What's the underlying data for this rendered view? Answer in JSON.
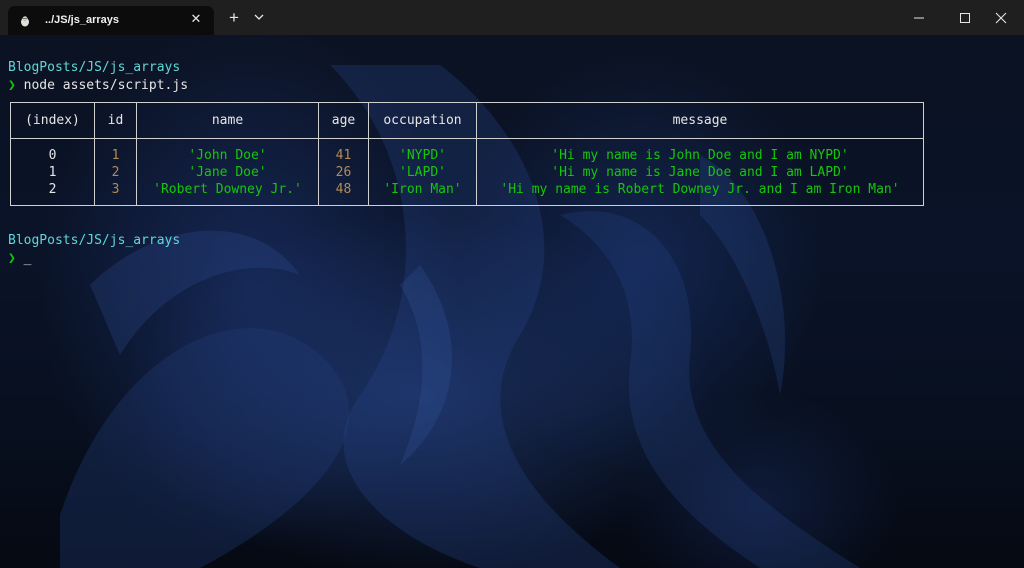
{
  "titlebar": {
    "tab_title": "../JS/js_arrays",
    "tab_icon": "linux-penguin-icon",
    "close_tab_glyph": "✕",
    "new_tab_glyph": "+",
    "dropdown_icon": "chevron-down-icon"
  },
  "terminal": {
    "path_1": "BlogPosts/JS/js_arrays",
    "prompt_1": "❯",
    "command_1": "node assets/script.js",
    "path_2": "BlogPosts/JS/js_arrays",
    "prompt_2": "❯",
    "cursor": "_"
  },
  "table": {
    "headers": [
      "(index)",
      "id",
      "name",
      "age",
      "occupation",
      "message"
    ],
    "rows": [
      {
        "index": "0",
        "id": "1",
        "name": "'John Doe'",
        "age": "41",
        "occupation": "'NYPD'",
        "message": "'Hi my name is John Doe and I am NYPD'"
      },
      {
        "index": "1",
        "id": "2",
        "name": "'Jane Doe'",
        "age": "26",
        "occupation": "'LAPD'",
        "message": "'Hi my name is Jane Doe and I am LAPD'"
      },
      {
        "index": "2",
        "id": "3",
        "name": "'Robert Downey Jr.'",
        "age": "48",
        "occupation": "'Iron Man'",
        "message": "'Hi my name is Robert Downey Jr. and I am Iron Man'"
      }
    ]
  },
  "colors": {
    "path": "#61d6d6",
    "prompt": "#16c60c",
    "string": "#16c60c",
    "number": "#b48b55",
    "text": "#e6e6e6"
  }
}
